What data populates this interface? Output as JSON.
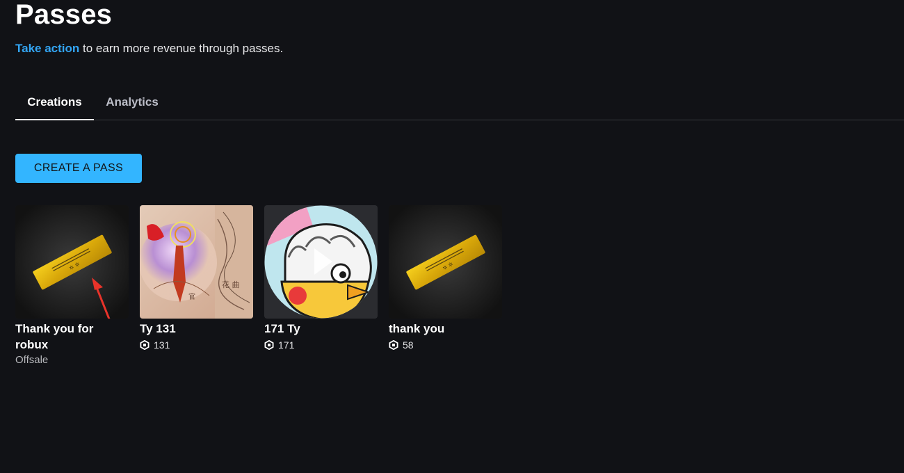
{
  "header": {
    "title": "Passes",
    "subtitle_link": "Take action",
    "subtitle_rest": " to earn more revenue through passes."
  },
  "tabs": [
    {
      "label": "Creations",
      "active": true
    },
    {
      "label": "Analytics",
      "active": false
    }
  ],
  "create_button_label": "CREATE A PASS",
  "colors": {
    "background": "#111216",
    "accent": "#33b5ff",
    "link": "#33a6f5"
  },
  "passes": [
    {
      "name": "Thank you for robux",
      "status": "Offsale",
      "image": "gold-ticket-icon"
    },
    {
      "name": "Ty 131",
      "price": "131",
      "price_icon": "robux-icon",
      "image": "collage-photo"
    },
    {
      "name": "171 Ty",
      "price": "171",
      "price_icon": "robux-icon",
      "image": "cartoon-bird-avatar"
    },
    {
      "name": "thank you",
      "price": "58",
      "price_icon": "robux-icon",
      "image": "gold-ticket-icon"
    }
  ]
}
